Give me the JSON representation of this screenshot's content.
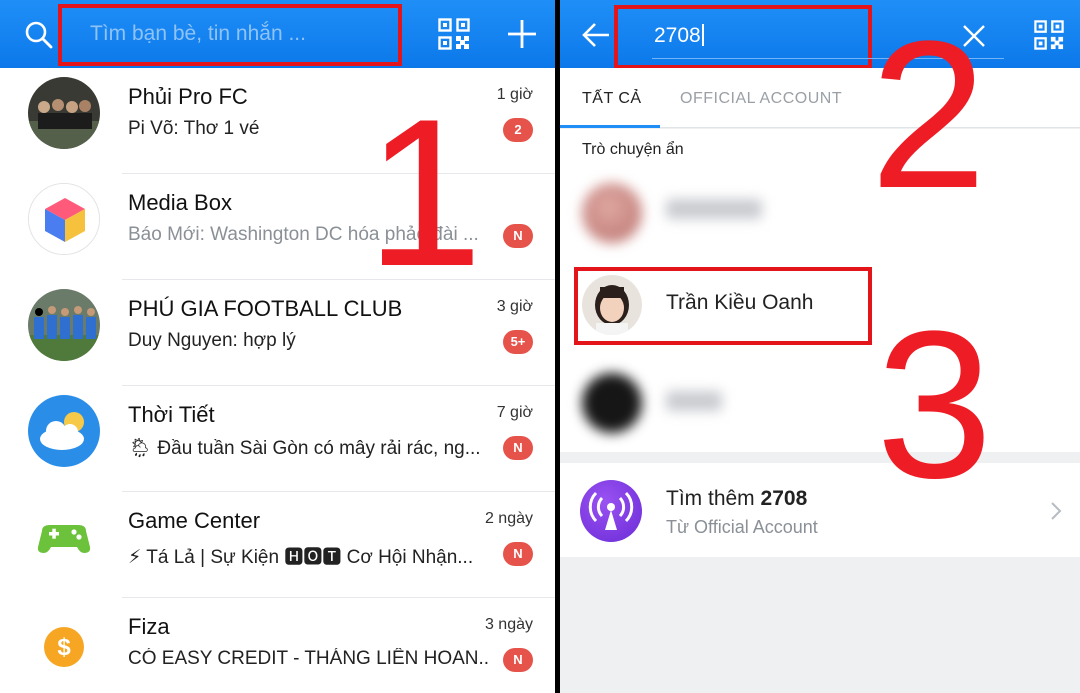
{
  "colors": {
    "accent": "#0c78ea",
    "highlight": "#e4141b",
    "badge": "#e5534b"
  },
  "step_numbers": [
    "1",
    "2",
    "3"
  ],
  "left": {
    "search": {
      "placeholder": "Tìm bạn bè, tin nhắn ...",
      "icon": "search-icon"
    },
    "header_icons": [
      "qr-code-icon",
      "plus-icon"
    ],
    "chats": [
      {
        "name": "Phủi Pro FC",
        "message": "Pi Võ: Thơ 1 vé",
        "time": "1 giờ",
        "badge": "2",
        "muted": false
      },
      {
        "name": "Media Box",
        "message": "Báo Mới: Washington DC hóa phảo đài ...",
        "time": "",
        "badge": "N",
        "muted": true
      },
      {
        "name": "PHÚ GIA FOOTBALL CLUB",
        "message": "Duy Nguyen: hợp lý",
        "time": "3 giờ",
        "badge": "5+",
        "muted": false
      },
      {
        "name": "Thời Tiết",
        "message": "🌦 Đầu tuần Sài Gòn có mây rải rác, ng...",
        "time": "7 giờ",
        "badge": "N",
        "muted": false
      },
      {
        "name": "Game Center",
        "message": "⚡ Tá Lả | Sự Kiện 🅷🅾🆃 Cơ Hội Nhận...",
        "time": "2 ngày",
        "badge": "N",
        "muted": false
      },
      {
        "name": "Fiza",
        "message": "CÓ EASY CREDIT - THÁNG LIÊN HOAN...",
        "time": "3 ngày",
        "badge": "N",
        "muted": false
      }
    ]
  },
  "right": {
    "query": "2708",
    "header_icons": [
      "back-arrow-icon",
      "clear-icon",
      "qr-code-icon"
    ],
    "tabs": [
      {
        "label": "TẤT CẢ",
        "active": true
      },
      {
        "label": "OFFICIAL ACCOUNT",
        "active": false
      }
    ],
    "section_label": "Trò chuyện ẩn",
    "results": [
      {
        "name": "",
        "blurred": true
      },
      {
        "name": "Trần Kiều Oanh",
        "blurred": false
      },
      {
        "name": "",
        "blurred": true
      }
    ],
    "more": {
      "prefix": "Tìm thêm",
      "query": "2708",
      "subtitle": "Từ Official Account",
      "icon": "broadcast-icon"
    }
  }
}
